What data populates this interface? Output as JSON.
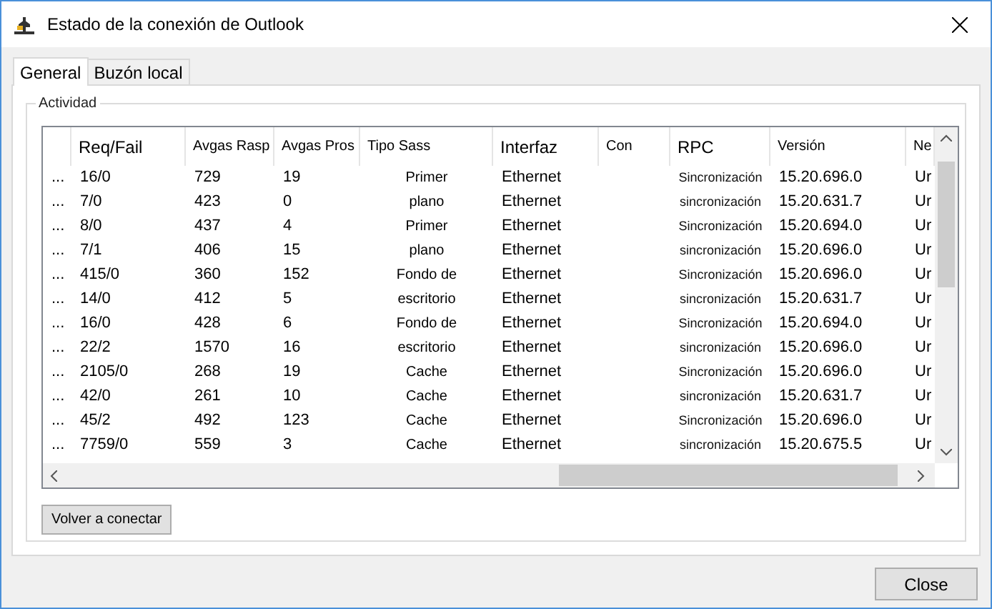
{
  "window": {
    "title": "Estado de la conexión de Outlook"
  },
  "tabs": [
    {
      "label": "General",
      "selected": true
    },
    {
      "label": "Buzón local",
      "selected": false
    }
  ],
  "group": {
    "label": "Actividad"
  },
  "table": {
    "columns": [
      "",
      "Req/Fail",
      "Avgas Rasp",
      "Avgas Pros",
      "Tipo Sass",
      "Interfaz",
      "Con",
      "RPC",
      "Versión",
      "Ne"
    ],
    "rows": [
      [
        "...",
        "16/0",
        "729",
        "19",
        "Primer",
        "Ethernet",
        "",
        "Sincronización",
        "15.20.696.0",
        "Ur"
      ],
      [
        "...",
        "7/0",
        "423",
        "0",
        "plano",
        "Ethernet",
        "",
        "sincronización",
        "15.20.631.7",
        "Ur"
      ],
      [
        "...",
        "8/0",
        "437",
        "4",
        "Primer",
        "Ethernet",
        "",
        "Sincronización",
        "15.20.694.0",
        "Ur"
      ],
      [
        "...",
        "7/1",
        "406",
        "15",
        "plano",
        "Ethernet",
        "",
        "sincronización",
        "15.20.696.0",
        "Ur"
      ],
      [
        "...",
        "415/0",
        "360",
        "152",
        "Fondo de",
        "Ethernet",
        "",
        "Sincronización",
        "15.20.696.0",
        "Ur"
      ],
      [
        "...",
        "14/0",
        "412",
        "5",
        "escritorio",
        "Ethernet",
        "",
        "sincronización",
        "15.20.631.7",
        "Ur"
      ],
      [
        "...",
        "16/0",
        "428",
        "6",
        "Fondo de",
        "Ethernet",
        "",
        "Sincronización",
        "15.20.694.0",
        "Ur"
      ],
      [
        "...",
        "22/2",
        "1570",
        "16",
        "escritorio",
        "Ethernet",
        "",
        "sincronización",
        "15.20.696.0",
        "Ur"
      ],
      [
        "...",
        "2105/0",
        "268",
        "19",
        "Cache",
        "Ethernet",
        "",
        "Sincronización",
        "15.20.696.0",
        "Ur"
      ],
      [
        "...",
        "42/0",
        "261",
        "10",
        "Cache",
        "Ethernet",
        "",
        "sincronización",
        "15.20.631.7",
        "Ur"
      ],
      [
        "...",
        "45/2",
        "492",
        "123",
        "Cache",
        "Ethernet",
        "",
        "Sincronización",
        "15.20.696.0",
        "Ur"
      ],
      [
        "...",
        "7759/0",
        "559",
        "3",
        "Cache",
        "Ethernet",
        "",
        "sincronización",
        "15.20.675.5",
        "Ur"
      ]
    ]
  },
  "buttons": {
    "reconnect": "Volver a conectar",
    "close": "Close"
  }
}
